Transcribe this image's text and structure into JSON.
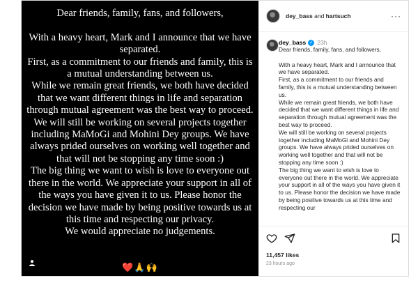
{
  "media": {
    "text": "Dear friends, family, fans, and followers,\n\nWith a heavy heart, Mark and I  announce that we have separated.\nFirst, as a commitment to our friends and family, this is a mutual understanding between us.\nWhile we remain great friends, we both have decided that we want different things in life and separation through mutual agreement was the best way to proceed.\nWe will still be working on several projects together including MaMoGi and Mohini Dey groups. We have always prided ourselves on working well together and that will not be stopping any time soon :)\nThe big thing we want to wish is love to everyone out there in the world. We appreciate your support in all of the ways you have given it to us. Please honor the decision we have made by being positive towards us at this time and respecting our privacy.\nWe would appreciate no judgements.",
    "emoji": "❤️🙏🙌"
  },
  "header": {
    "user1": "dey_bass",
    "joiner": " and ",
    "user2": "hartsuch",
    "more": "···"
  },
  "caption": {
    "user": "dey_bass",
    "verified": "✓",
    "time": "23h",
    "text": "Dear friends, family, fans, and followers,\n\nWith a heavy heart, Mark and I announce that we have separated.\nFirst, as a commitment to our friends and family, this is a mutual understanding between us.\nWhile we remain great friends, we both have decided that we want different things in life and separation through mutual agreement was the best way to proceed.\nWe will still be working on several projects together including MaMoGi and Mohini Dey groups. We have always prided ourselves on working well together and that will not be stopping any time soon :)\nThe big thing we want to wish is love to everyone out there in the world. We appreciate your support in all of the ways you have given it to us. Please honor the decision we have made by being positive towards us at this time and respecting our"
  },
  "footer": {
    "likes": "11,457 likes",
    "ago": "23 hours ago"
  },
  "colors": {
    "accent": "#0095f6",
    "text": "#262626",
    "muted": "#8e8e8e"
  },
  "icons": [
    "heart-icon",
    "share-icon",
    "bookmark-icon",
    "user-tag-icon",
    "more-icon",
    "verified-icon"
  ]
}
